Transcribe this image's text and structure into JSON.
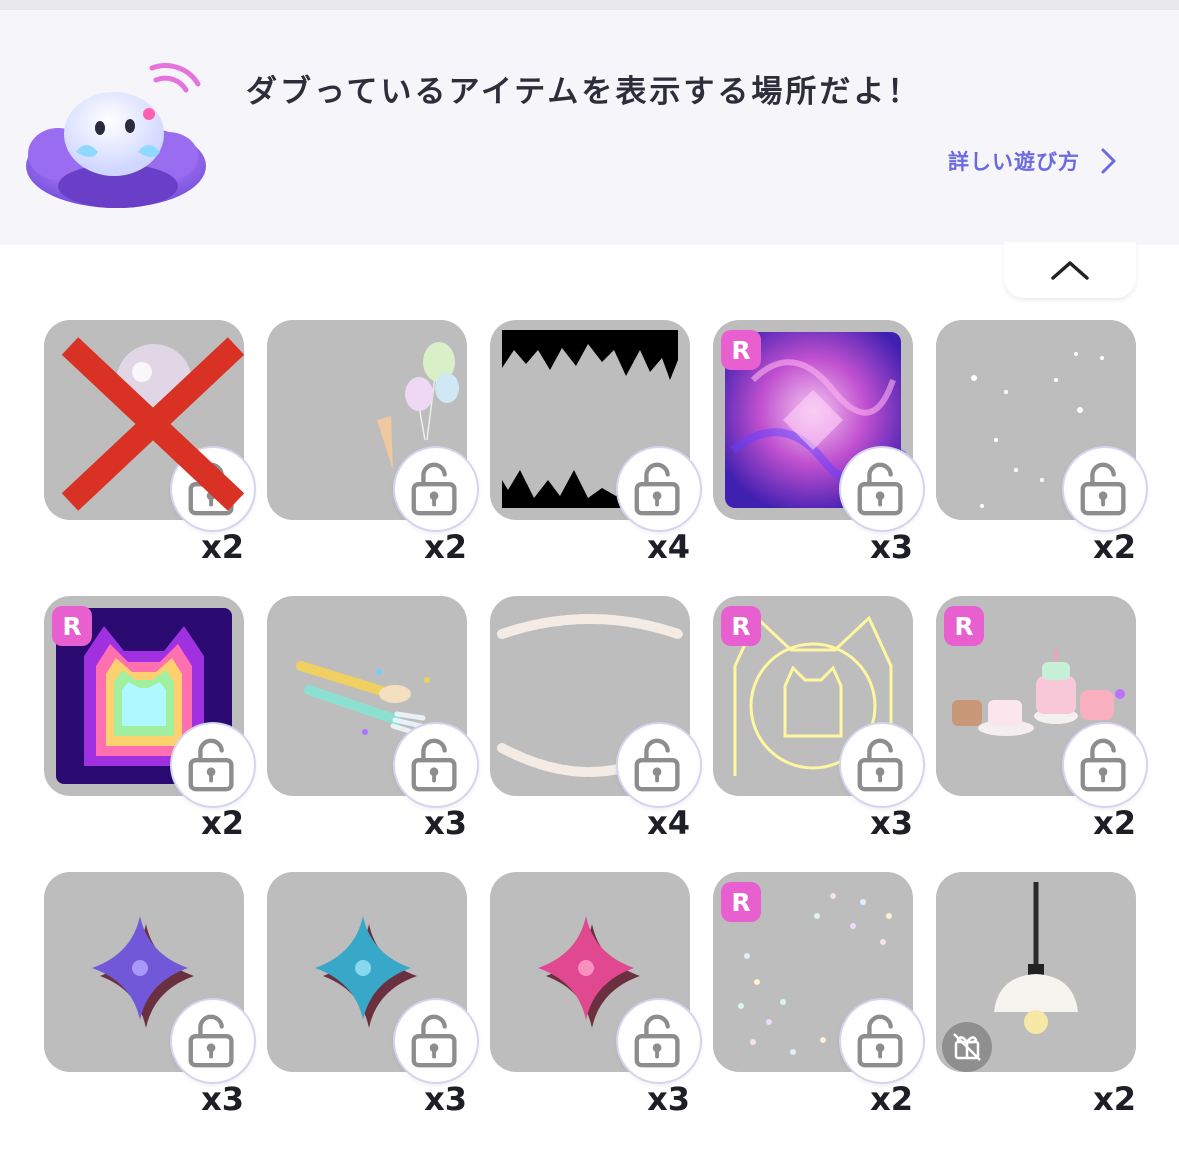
{
  "header": {
    "title": "ダブっているアイテムを表示する場所だよ！",
    "howto_label": "詳しい遊び方"
  },
  "icons": {
    "howto_arrow": "chevron-right-icon",
    "collapse": "chevron-up-icon",
    "lock": "unlock-icon",
    "gift_disabled": "gift-disabled-icon"
  },
  "colors": {
    "header_bg": "#f5f5fa",
    "accent": "#6c6ae0",
    "tile_bg": "#bdbdbd",
    "rare_badge": "#e85fd0",
    "strike": "#d93225"
  },
  "items": [
    {
      "count": "x2",
      "badge": "",
      "crossed_out": true
    },
    {
      "count": "x2",
      "badge": ""
    },
    {
      "count": "x4",
      "badge": ""
    },
    {
      "count": "x3",
      "badge": "R"
    },
    {
      "count": "x2",
      "badge": ""
    },
    {
      "count": "x2",
      "badge": "R"
    },
    {
      "count": "x3",
      "badge": ""
    },
    {
      "count": "x4",
      "badge": ""
    },
    {
      "count": "x3",
      "badge": "R"
    },
    {
      "count": "x2",
      "badge": "R"
    },
    {
      "count": "x3",
      "badge": ""
    },
    {
      "count": "x3",
      "badge": ""
    },
    {
      "count": "x3",
      "badge": ""
    },
    {
      "count": "x2",
      "badge": "R"
    },
    {
      "count": "x2",
      "badge": ""
    }
  ]
}
